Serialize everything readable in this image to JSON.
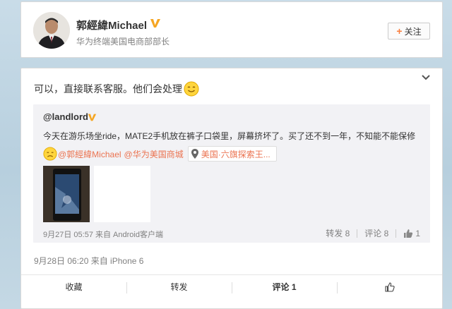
{
  "profile": {
    "name": "郭經緯Michael",
    "title": "华为终端美国电商部部长",
    "follow_label": "关注"
  },
  "post": {
    "text": "可以，直接联系客服。他们会处理",
    "timestamp": "9月28日 06:20 来自 iPhone 6",
    "repost": {
      "user": "@landlord",
      "text": "今天在游乐场坐ride，MATE2手机放在裤子口袋里，屏幕挤坏了。买了还不到一年，不知能不能保修",
      "mentions": [
        "@郭經緯Michael",
        "@华为美国商城"
      ],
      "location": "美国·六旗探索王...",
      "timestamp": "9月27日 05:57 来自 Android客户端",
      "repost_label": "转发 8",
      "comment_label": "评论 8",
      "like_count": "1"
    }
  },
  "actions": {
    "favorite": "收藏",
    "repost": "转发",
    "comment": "评论 1"
  },
  "colors": {
    "accent": "#eb7350",
    "verified": "#f5a623",
    "follow_plus": "#fa7d3c"
  }
}
